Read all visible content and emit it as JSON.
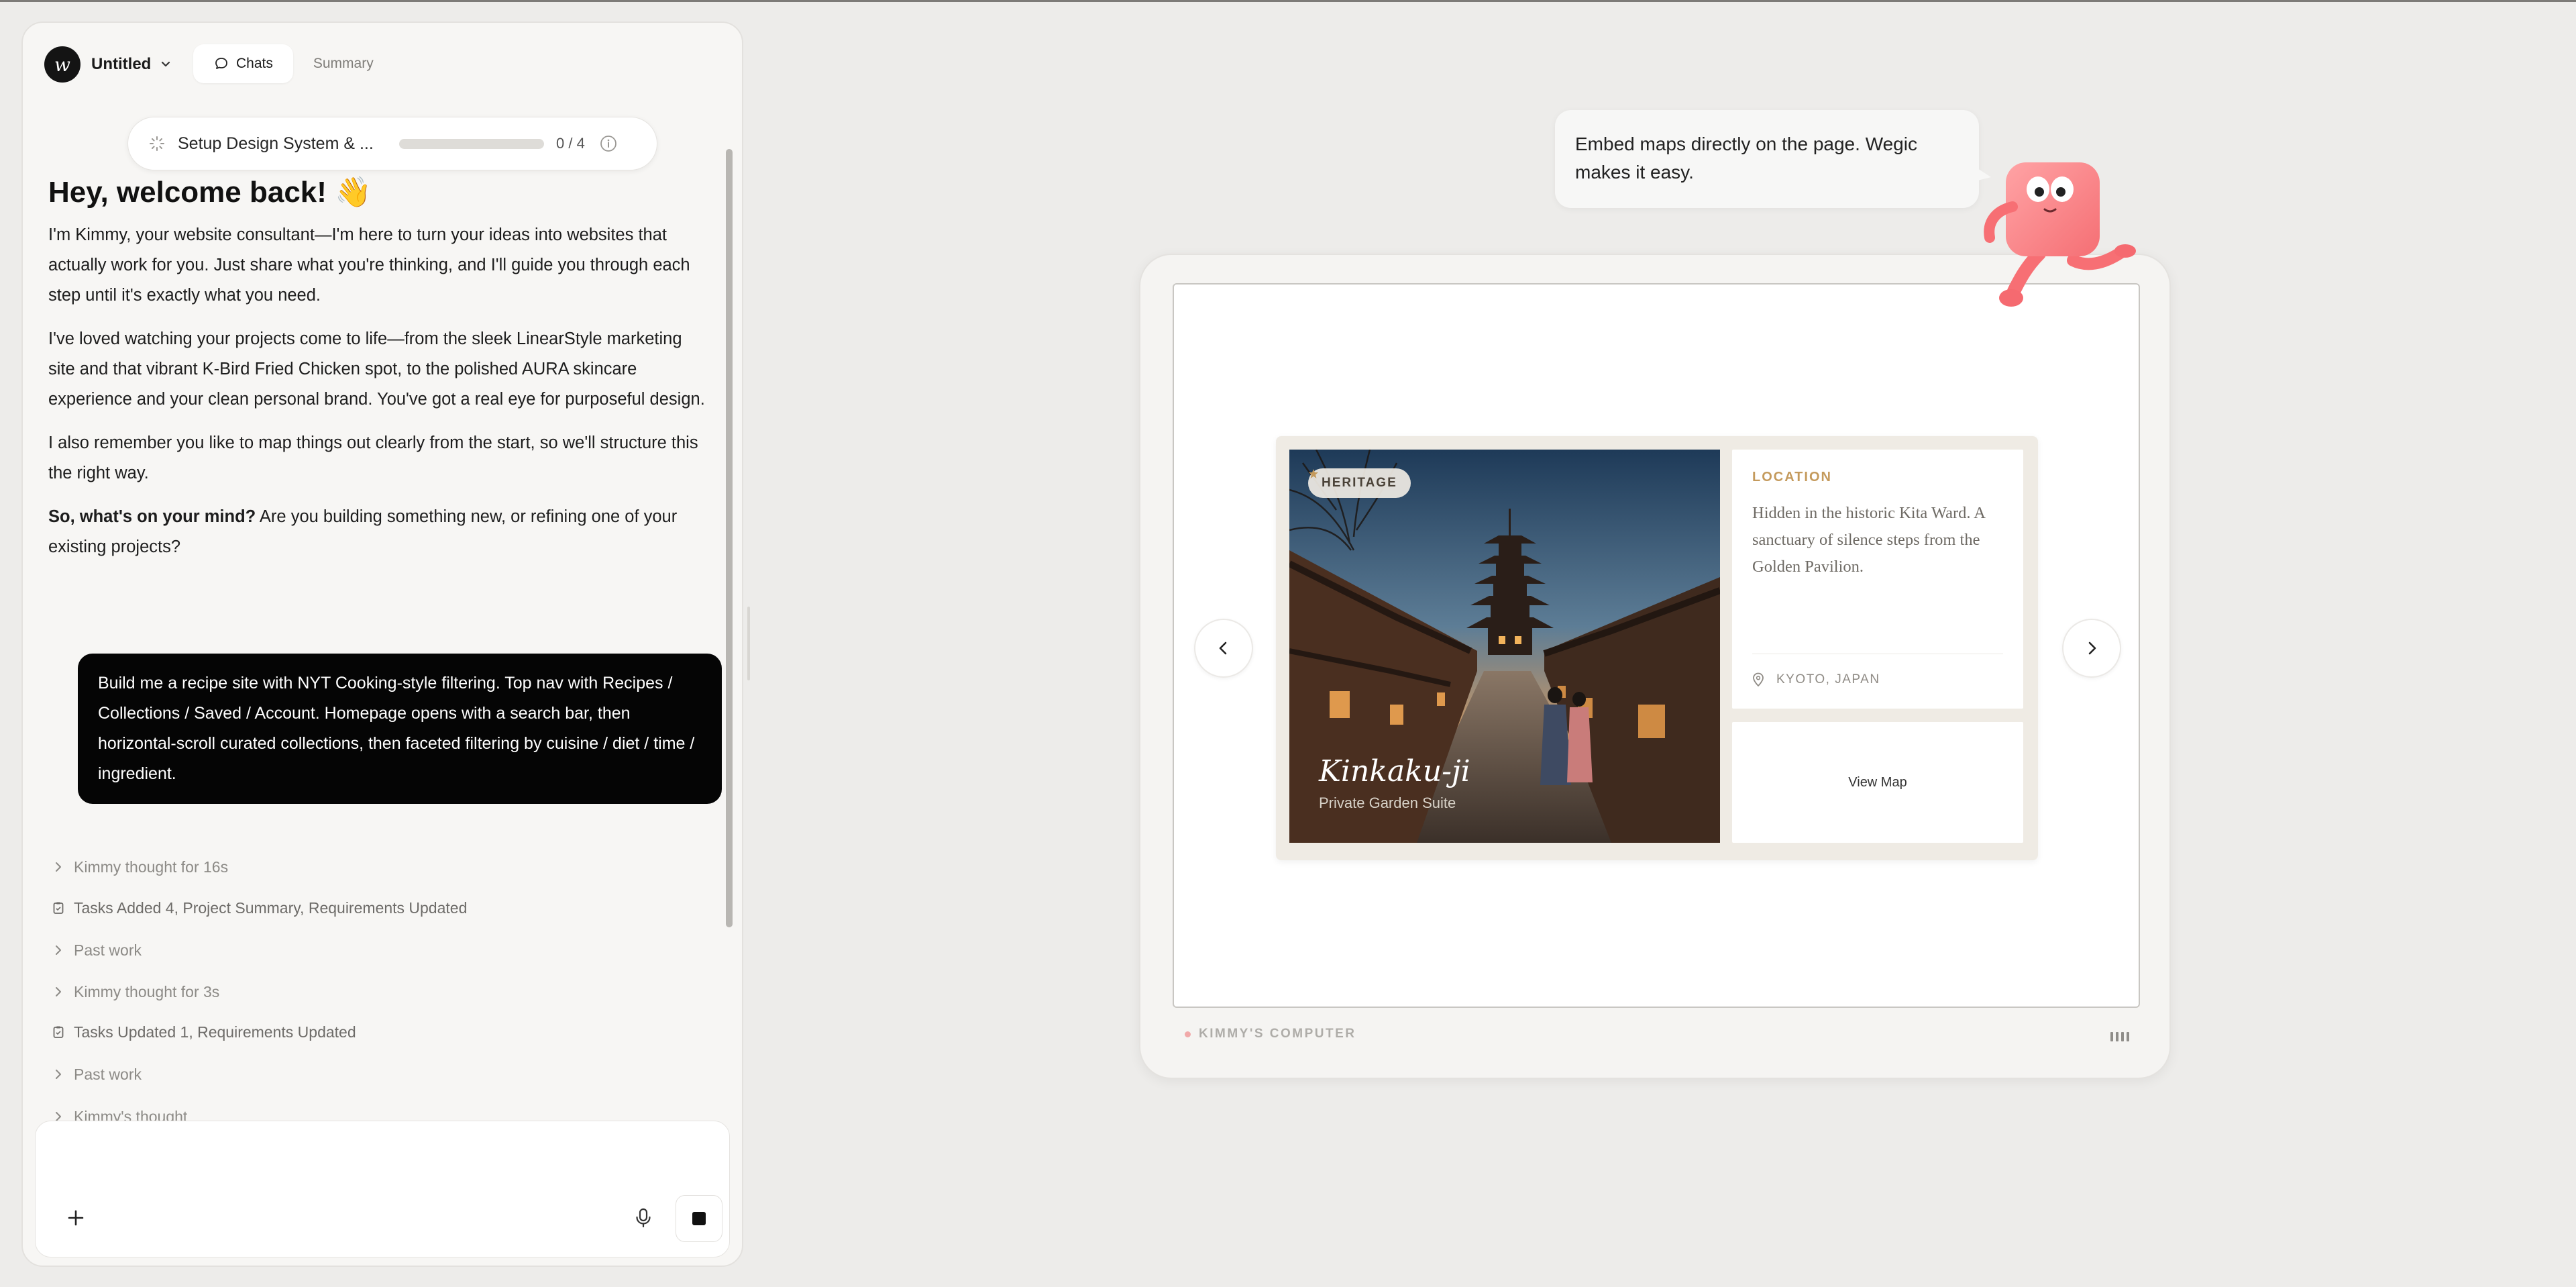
{
  "app": {
    "project_name": "Untitled",
    "logo_glyph": "w",
    "tabs": [
      {
        "label": "Chats",
        "icon": "chat-bubble-icon",
        "active": true
      },
      {
        "label": "Summary",
        "active": false
      }
    ]
  },
  "progress": {
    "label": "Setup Design System & ...",
    "count": "0 / 4",
    "fraction": 0
  },
  "chat": {
    "welcome_title": "Hey, welcome back! 👋",
    "para1": "I'm Kimmy, your website consultant—I'm here to turn your ideas into websites that actually work for you. Just share what you're thinking, and I'll guide you through each step until it's exactly what you need.",
    "para2": "I've loved watching your projects come to life—from the sleek LinearStyle marketing site and that vibrant K-Bird Fried Chicken spot, to the polished AURA skincare experience and your clean personal brand. You've got a real eye for purposeful design.",
    "para3": "I also remember you like to map things out clearly from the start, so we'll structure this the right way.",
    "para4_bold": "So, what's on your mind?",
    "para4_rest": " Are you building something new, or refining one of your existing projects?",
    "user_message": "Build me a recipe site with NYT Cooking-style filtering. Top nav with Recipes / Collections / Saved / Account. Homepage opens with a search bar, then horizontal-scroll curated collections, then faceted filtering by cuisine / diet / time / ingredient.",
    "activities": [
      {
        "type": "thought",
        "label": "Kimmy thought for 16s"
      },
      {
        "type": "task",
        "label": "Tasks Added 4, Project Summary, Requirements Updated"
      },
      {
        "type": "thought",
        "label": "Past work"
      },
      {
        "type": "thought",
        "label": "Kimmy thought for 3s"
      },
      {
        "type": "task",
        "label": "Tasks Updated 1, Requirements Updated"
      },
      {
        "type": "thought",
        "label": "Past work"
      },
      {
        "type": "thought",
        "label": "Kimmy's thought"
      }
    ]
  },
  "composer": {
    "placeholder": ""
  },
  "preview": {
    "bubble_text": "Embed maps directly on the page. Wegic makes it easy.",
    "device_label": "KIMMY'S COMPUTER",
    "card": {
      "badge": "HERITAGE",
      "title": "Kinkaku-ji",
      "subtitle": "Private Garden Suite",
      "location_heading": "LOCATION",
      "location_body": "Hidden in the historic Kita Ward. A sanctuary of silence steps from the Golden Pavilion.",
      "place": "KYOTO, JAPAN",
      "map_button": "View Map"
    }
  },
  "colors": {
    "accent_gold": "#c49a5c",
    "user_bubble": "#050505",
    "mascot_pink": "#ff8a8e"
  }
}
